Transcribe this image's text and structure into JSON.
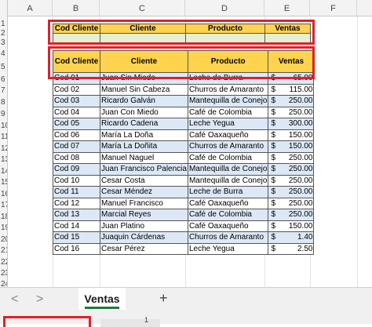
{
  "sheet": {
    "columns": [
      "A",
      "B",
      "C",
      "D",
      "E",
      "F"
    ],
    "rows": [
      "1",
      "2",
      "3",
      "4",
      "5",
      "6",
      "7",
      "8",
      "9",
      "10",
      "11",
      "12",
      "13",
      "14",
      "15",
      "16",
      "17",
      "18",
      "19",
      "20",
      "21",
      "22",
      "23",
      "24"
    ]
  },
  "criteria": {
    "headers": [
      "Cod Cliente",
      "Cliente",
      "Producto",
      "Ventas"
    ],
    "values": [
      "",
      "",
      "",
      ""
    ]
  },
  "table": {
    "headers": [
      "Cod Cliente",
      "Cliente",
      "Producto",
      "Ventas"
    ],
    "currency": "$",
    "rows": [
      [
        "Cod 01",
        "Juan Sin Miedo",
        "Leche de Burra",
        "65.00"
      ],
      [
        "Cod 02",
        "Manuel Sin Cabeza",
        "Churros de Amaranto",
        "115.00"
      ],
      [
        "Cod 03",
        "Ricardo Galván",
        "Mantequilla de Conejo",
        "250.00"
      ],
      [
        "Cod 04",
        "Juan Con Miedo",
        "Café de Colombia",
        "250.00"
      ],
      [
        "Cod 05",
        "Ricardo Cadena",
        "Leche Yegua",
        "300.00"
      ],
      [
        "Cod 06",
        "María La Doña",
        "Café Oaxaqueño",
        "150.00"
      ],
      [
        "Cod 07",
        "María La Doñita",
        "Churros de Amaranto",
        "150.00"
      ],
      [
        "Cod 08",
        "Manuel Naguel",
        "Café de Colombia",
        "250.00"
      ],
      [
        "Cod 09",
        "Juan Francisco Palencia",
        "Mantequilla de Conejo",
        "250.00"
      ],
      [
        "Cod 10",
        "Cesar Costa",
        "Mantequilla de Conejo",
        "250.00"
      ],
      [
        "Cod 11",
        "Cesar Méndez",
        "Leche de Burra",
        "250.00"
      ],
      [
        "Cod 12",
        "Manuel Francisco",
        "Café Oaxaqueño",
        "250.00"
      ],
      [
        "Cod 13",
        "Marcial Reyes",
        "Café de Colombia",
        "250.00"
      ],
      [
        "Cod 14",
        "Juan Platino",
        "Café Oaxaqueño",
        "150.00"
      ],
      [
        "Cod 15",
        "Juaquin Cárdenas",
        "Churros de Amaranto",
        "1.40"
      ],
      [
        "Cod 16",
        "Cesar Pérez",
        "Leche Yegua",
        "2.50"
      ]
    ]
  },
  "tabs": {
    "prev": "<",
    "next": ">",
    "active": "Ventas",
    "add": "+"
  },
  "status": {
    "page_number": "1"
  },
  "colors": {
    "header_yellow": "#ffd34d",
    "band_blue": "#dce8f6",
    "criteria_green": "#e4efd3",
    "highlight_red": "#e0202a",
    "tab_green": "#1f7a3a"
  }
}
